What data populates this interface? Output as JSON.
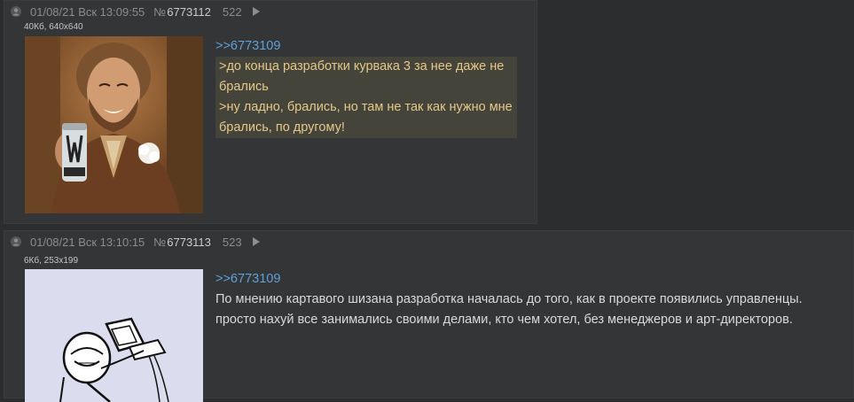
{
  "posts": [
    {
      "date": "01/08/21 Вск 13:09:55",
      "num_prefix": "№",
      "num": "6773112",
      "order": "522",
      "file_info": "40Кб, 640x640",
      "reply_to": ">>6773109",
      "quote": ">до конца разработки курвака 3 за нее даже не брались\n>ну ладно, брались, но там не так как нужно мне брались, по другому!",
      "text": ""
    },
    {
      "date": "01/08/21 Вск 13:10:15",
      "num_prefix": "№",
      "num": "6773113",
      "order": "523",
      "file_info": "6Кб, 253x199",
      "reply_to": ">>6773109",
      "quote": "",
      "text": "По мнению картавого шизана разработка началась до того, как в проекте появились управленцы. просто нахуй все занимались своими делами, кто чем хотел, без менеджеров и арт-директоров."
    }
  ],
  "colors": {
    "background": "#2b2d2f",
    "post_background": "#333537",
    "link": "#5fa0d7",
    "quote_text": "#e4c88a",
    "quote_background": "#45443b"
  },
  "icons": {
    "avatar": "user-avatar-icon",
    "play": "play-icon"
  }
}
